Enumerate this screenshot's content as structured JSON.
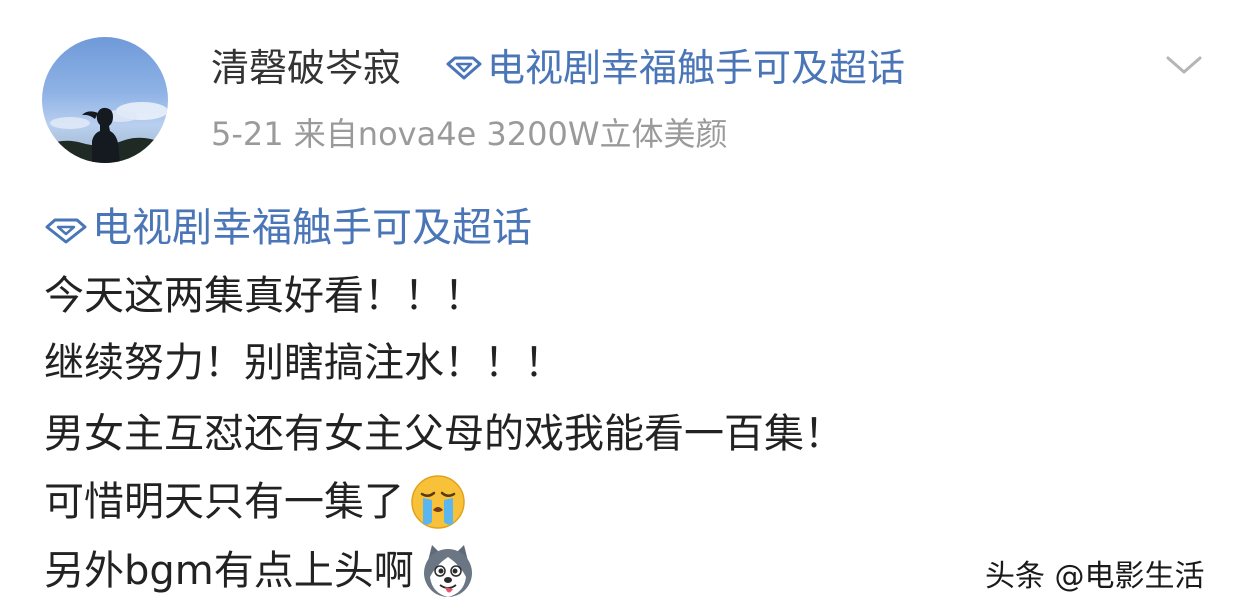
{
  "post": {
    "username": "清磬破岑寂",
    "header_topic": "电视剧幸福触手可及超话",
    "meta": "5-21  来自nova4e 3200W立体美颜",
    "body_topic": "电视剧幸福触手可及超话",
    "lines": [
      "今天这两集真好看！！！",
      "继续努力！别瞎搞注水！！！",
      "男女主互怼还有女主父母的戏我能看一百集！",
      "可惜明天只有一集了",
      "另外bgm有点上头啊"
    ],
    "emojis": [
      "crying-face-emoji",
      "husky-dog-emoji"
    ]
  },
  "watermark": "头条 @电影生活",
  "colors": {
    "topic_blue": "#4a76b8",
    "username": "#333333",
    "meta_gray": "#9a9a9a",
    "body_text": "#222222"
  },
  "icons": [
    "super-topic-diamond-icon",
    "chevron-down-icon"
  ]
}
